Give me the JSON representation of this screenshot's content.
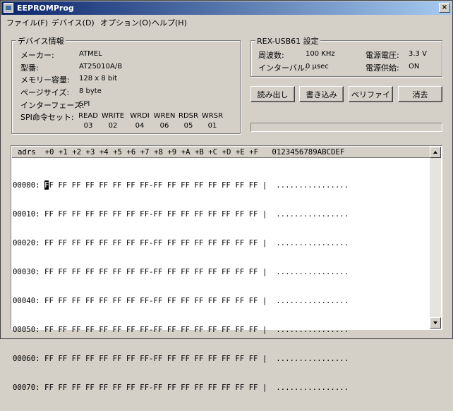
{
  "window": {
    "title": "EEPROMProg",
    "close_glyph": "×"
  },
  "menu": [
    "ファイル(F)",
    "デバイス(D)",
    "オプション(O)",
    "ヘルプ(H)"
  ],
  "device_info": {
    "title": "デバイス情報",
    "fields": [
      {
        "label": "メーカー:",
        "value": "ATMEL"
      },
      {
        "label": "型番:",
        "value": "AT25010A/B"
      },
      {
        "label": "メモリー容量:",
        "value": "128 x 8 bit"
      },
      {
        "label": "ページサイズ:",
        "value": "8 byte"
      },
      {
        "label": "インターフェース:",
        "value": "SPI"
      }
    ],
    "spi_label": "SPI命令セット:",
    "spi": [
      {
        "name": "READ",
        "code": "03"
      },
      {
        "name": "WRITE",
        "code": "02"
      },
      {
        "name": "WRDI",
        "code": "04"
      },
      {
        "name": "WREN",
        "code": "06"
      },
      {
        "name": "RDSR",
        "code": "05"
      },
      {
        "name": "WRSR",
        "code": "01"
      }
    ]
  },
  "rex": {
    "title": "REX-USB61 設定",
    "freq_label": "周波数:",
    "freq_value": "100 KHz",
    "interval_label": "インターバル:",
    "interval_value": "0 μsec",
    "voltage_label": "電源電圧:",
    "voltage_value": "3.3 V",
    "supply_label": "電源供給:",
    "supply_value": "ON"
  },
  "buttons": {
    "read": "読み出し",
    "write": "書き込み",
    "verify": "ベリファイ",
    "erase": "消去"
  },
  "hex": {
    "header": "adrs  +0 +1 +2 +3 +4 +5 +6 +7 +8 +9 +A +B +C +D +E +F   0123456789ABCDEF",
    "rows": [
      {
        "addr": "00000:",
        "first": "F",
        "rest": "F FF FF FF FF FF FF FF-FF FF FF FF FF FF FF FF |  ................"
      },
      {
        "addr": "00010:",
        "first": "",
        "rest": " FF FF FF FF FF FF FF FF-FF FF FF FF FF FF FF FF |  ................"
      },
      {
        "addr": "00020:",
        "first": "",
        "rest": " FF FF FF FF FF FF FF FF-FF FF FF FF FF FF FF FF |  ................"
      },
      {
        "addr": "00030:",
        "first": "",
        "rest": " FF FF FF FF FF FF FF FF-FF FF FF FF FF FF FF FF |  ................"
      },
      {
        "addr": "00040:",
        "first": "",
        "rest": " FF FF FF FF FF FF FF FF-FF FF FF FF FF FF FF FF |  ................"
      },
      {
        "addr": "00050:",
        "first": "",
        "rest": " FF FF FF FF FF FF FF FF-FF FF FF FF FF FF FF FF |  ................"
      },
      {
        "addr": "00060:",
        "first": "",
        "rest": " FF FF FF FF FF FF FF FF-FF FF FF FF FF FF FF FF |  ................"
      },
      {
        "addr": "00070:",
        "first": "",
        "rest": " FF FF FF FF FF FF FF FF-FF FF FF FF FF FF FF FF |  ................"
      }
    ]
  }
}
